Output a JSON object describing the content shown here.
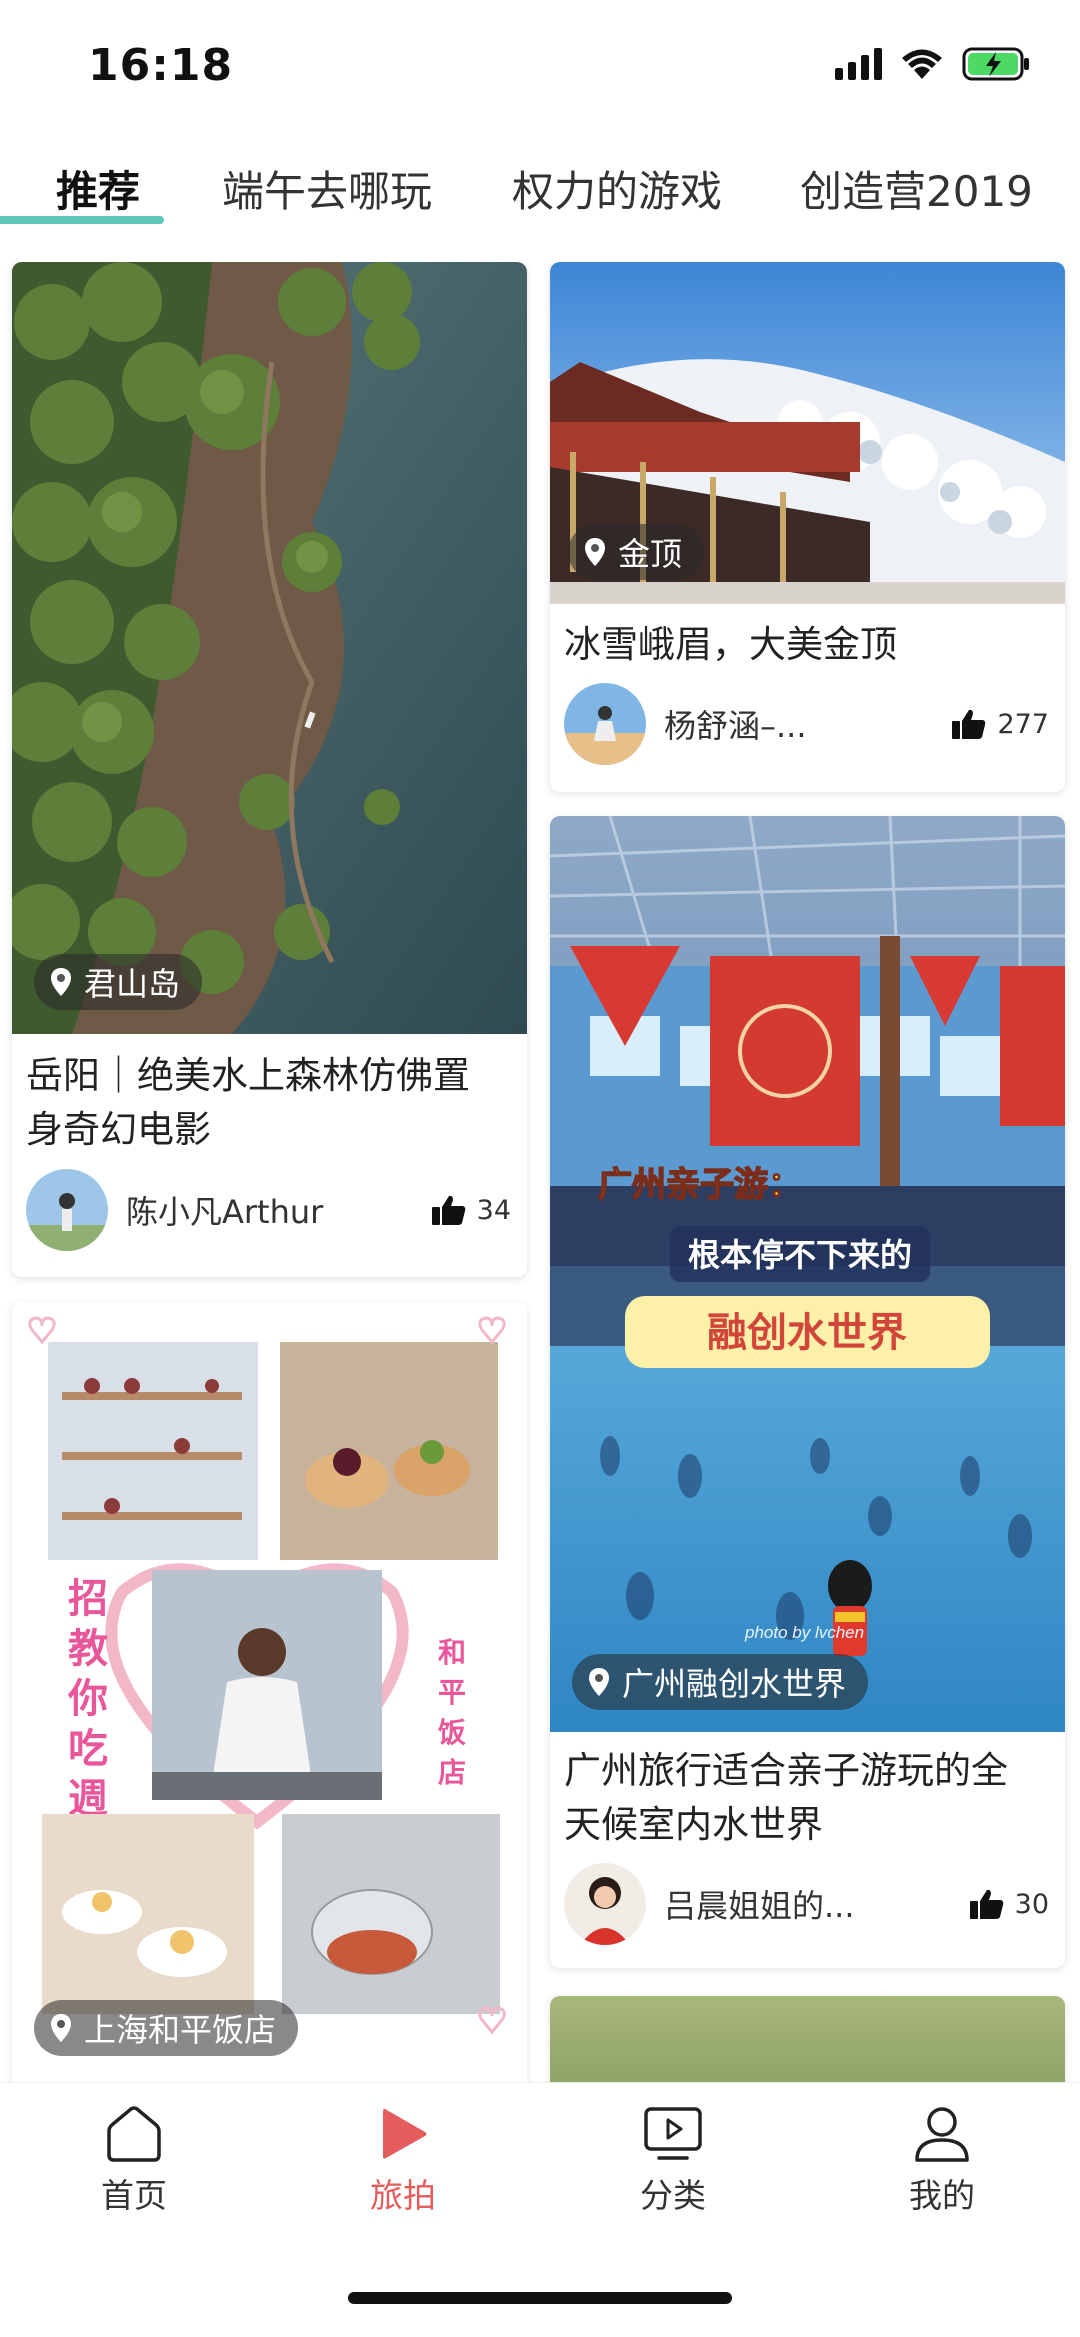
{
  "status_bar": {
    "time": "16:18"
  },
  "tabs": [
    {
      "label": "推荐",
      "active": true
    },
    {
      "label": "端午去哪玩",
      "active": false
    },
    {
      "label": "权力的游戏",
      "active": false
    },
    {
      "label": "创造营2019",
      "active": false
    }
  ],
  "cards": [
    {
      "location": "君山岛",
      "title_line1": "岳阳｜绝美水上森林仿佛置",
      "title_line2": "身奇幻电影",
      "author": "陈小凡Arthur",
      "likes": "34"
    },
    {
      "location": "金顶",
      "title_line1": "冰雪峨眉，大美金顶",
      "author": "杨舒涵–...",
      "likes": "277"
    },
    {
      "location": "广州融创水世界",
      "title_line1": "广州旅行适合亲子游玩的全",
      "title_line2": "天候室内水世界",
      "author": "吕晨姐姐的...",
      "likes": "30",
      "overlay_text": [
        "广州亲子游：",
        "根本停不下来的",
        "融创水世界"
      ],
      "watermark": "photo by lvchen"
    },
    {
      "location": "上海和平饭店",
      "overlay_left": "招教你吃週",
      "overlay_right": "和平饭店"
    }
  ],
  "bottom_nav": [
    {
      "label": "首页",
      "icon": "home-icon",
      "active": false
    },
    {
      "label": "旅拍",
      "icon": "play-icon",
      "active": true
    },
    {
      "label": "分类",
      "icon": "video-category-icon",
      "active": false
    },
    {
      "label": "我的",
      "icon": "user-icon",
      "active": false
    }
  ],
  "colors": {
    "accent": "#5fc7b8",
    "active_nav": "#e45c5c"
  }
}
